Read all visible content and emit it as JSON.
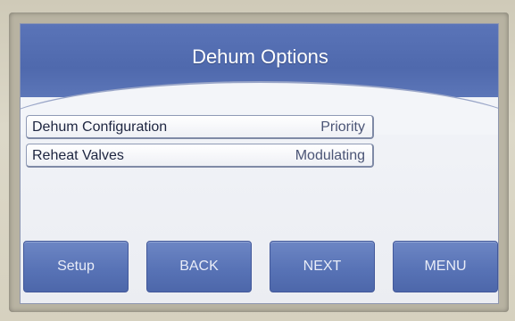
{
  "header": {
    "title": "Dehum Options"
  },
  "settings": [
    {
      "label": "Dehum Configuration",
      "value": "Priority"
    },
    {
      "label": "Reheat Valves",
      "value": "Modulating"
    }
  ],
  "footer": {
    "buttons": [
      "Setup",
      "BACK",
      "NEXT",
      "MENU"
    ]
  },
  "colors": {
    "accent": "#5873b6",
    "screen_background": "#f3f5f9",
    "text_dark": "#1d2540"
  }
}
